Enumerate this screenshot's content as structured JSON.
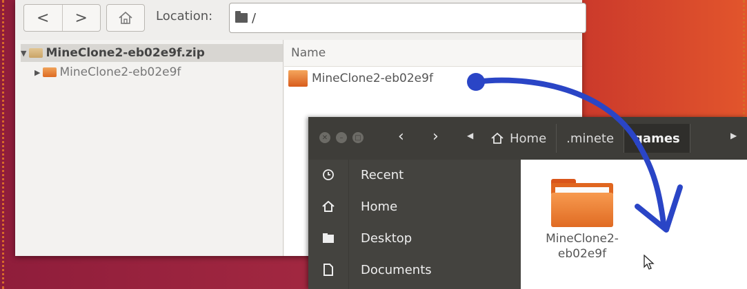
{
  "archive_window": {
    "toolbar": {
      "back_label": "<",
      "forward_label": ">",
      "location_label": "Location:",
      "location_value": "/"
    },
    "tree": {
      "root": "MineClone2-eb02e9f.zip",
      "child": "MineClone2-eb02e9f"
    },
    "filelist": {
      "column_name": "Name",
      "rows": [
        "MineClone2-eb02e9f"
      ]
    }
  },
  "files_window": {
    "breadcrumbs": [
      "Home",
      ".minete",
      "games"
    ],
    "sidebar": [
      {
        "label": "Recent",
        "icon": "clock-icon"
      },
      {
        "label": "Home",
        "icon": "home-icon"
      },
      {
        "label": "Desktop",
        "icon": "folder-icon"
      },
      {
        "label": "Documents",
        "icon": "document-icon"
      }
    ],
    "content": {
      "folder_name_line1": "MineClone2-",
      "folder_name_line2": "eb02e9f"
    }
  },
  "colors": {
    "arrow": "#2a45c6",
    "folder_orange": "#e06b23",
    "dark_header": "#3e3d39"
  }
}
